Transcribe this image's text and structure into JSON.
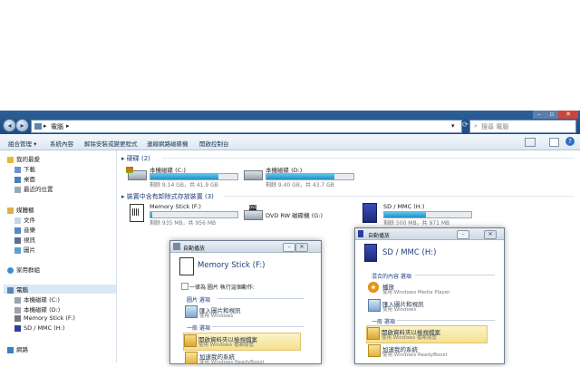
{
  "addressbar": {
    "root_label": "電腦",
    "chevron": "▸",
    "dropdown": "▾"
  },
  "search": {
    "placeholder": "搜尋 電腦",
    "icon": "search-icon"
  },
  "window_controls": {
    "minimize": "–",
    "maximize": "▫",
    "close": "✕"
  },
  "toolbar": {
    "items": [
      "組合管理 ▾",
      "系統內容",
      "解除安裝或變更程式",
      "連線網路磁碟機",
      "開啟控制台"
    ],
    "right_icons": [
      "view-options-icon",
      "preview-pane-icon",
      "help-icon"
    ]
  },
  "nav": {
    "favorites": "我的最愛",
    "fav_items": [
      "下載",
      "桌面",
      "最近的位置"
    ],
    "libraries": "媒體櫃",
    "lib_items": [
      "文件",
      "音樂",
      "視訊",
      "圖片"
    ],
    "homegroup": "家用群組",
    "computer": "電腦",
    "comp_items": [
      "本機磁碟 (C:)",
      "本機磁碟 (D:)",
      "Memory Stick (F:)",
      "SD / MMC (H:)"
    ],
    "network": "網路"
  },
  "content": {
    "group1": "▸ 硬碟 (2)",
    "group2": "▸ 裝置中含有卸除式存放裝置 (3)",
    "drives": [
      {
        "name": "本機磁碟 (C:)",
        "cap": "剩餘 9.14 GB，共 41.9 GB",
        "used": 0.78
      },
      {
        "name": "本機磁碟 (D:)",
        "cap": "剩餘 9.40 GB，共 43.7 GB",
        "used": 0.78
      }
    ],
    "removable": [
      {
        "name": "Memory Stick (F:)",
        "cap": "剩餘 935 MB，共 956 MB",
        "used": 0.02
      },
      {
        "name": "DVD RW 磁碟機 (G:)"
      },
      {
        "name": "SD / MMC (H:)",
        "cap": "剩餘 500 MB，共 971 MB",
        "used": 0.48
      }
    ]
  },
  "dialog1": {
    "title": "自動播放",
    "heading": "Memory Stick (F:)",
    "checkbox": "一律為 圖片 執行這個動作:",
    "sec1": "圖片 選項",
    "opt1_t1": "匯入圖片和視訊",
    "opt1_t2": "使用 Windows",
    "sec2": "一般 選項",
    "opt2_t1": "開啟資料夾以檢視檔案",
    "opt2_t2": "使用 Windows 檔案總管",
    "opt3_t1": "加速我的系統",
    "opt3_t2": "使用 Windows ReadyBoost"
  },
  "dialog2": {
    "title": "自動播放",
    "heading": "SD / MMC (H:)",
    "sec1": "混合的內容 選項",
    "opt1_t1": "播放",
    "opt1_t2": "使用 Windows Media Player",
    "opt2_t1": "匯入圖片和視訊",
    "opt2_t2": "使用 Windows",
    "sec2": "一般 選項",
    "opt3_t1": "開啟資料夾以檢視檔案",
    "opt3_t2": "使用 Windows 檔案總管",
    "opt4_t1": "加速我的系統",
    "opt4_t2": "使用 Windows ReadyBoost"
  }
}
